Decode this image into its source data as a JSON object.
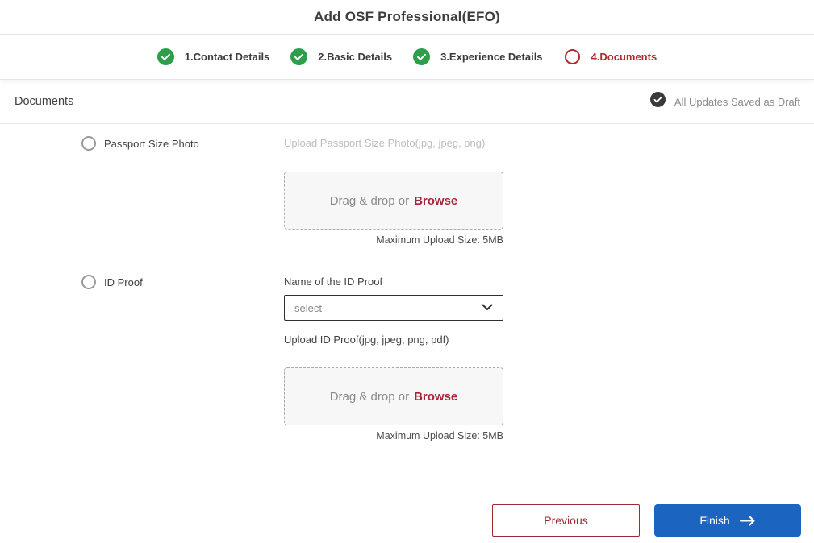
{
  "header": {
    "title": "Add OSF Professional(EFO)"
  },
  "stepper": {
    "steps": [
      {
        "label": "1.Contact Details",
        "state": "complete"
      },
      {
        "label": "2.Basic Details",
        "state": "complete"
      },
      {
        "label": "3.Experience Details",
        "state": "complete"
      },
      {
        "label": "4.Documents",
        "state": "current"
      }
    ]
  },
  "section": {
    "title": "Documents",
    "draft_status": "All Updates Saved as Draft"
  },
  "form": {
    "passport": {
      "radio_label": "Passport Size Photo",
      "upload_label": "Upload Passport Size Photo(jpg, jpeg, png)",
      "dropzone_text": "Drag & drop or",
      "browse_label": "Browse",
      "max_size": "Maximum Upload Size: 5MB"
    },
    "id_proof": {
      "radio_label": "ID Proof",
      "name_label": "Name of the ID Proof",
      "select_value": "select",
      "upload_label": "Upload ID Proof(jpg, jpeg, png, pdf)",
      "dropzone_text": "Drag & drop or",
      "browse_label": "Browse",
      "max_size": "Maximum Upload Size: 5MB"
    }
  },
  "footer": {
    "previous_label": "Previous",
    "finish_label": "Finish"
  },
  "colors": {
    "step_complete_green": "#2d9e49",
    "accent_red": "#a32638",
    "current_step_red": "#b02a2e",
    "finish_blue": "#1b65c0",
    "draft_icon_dark": "#3a3a3a"
  }
}
